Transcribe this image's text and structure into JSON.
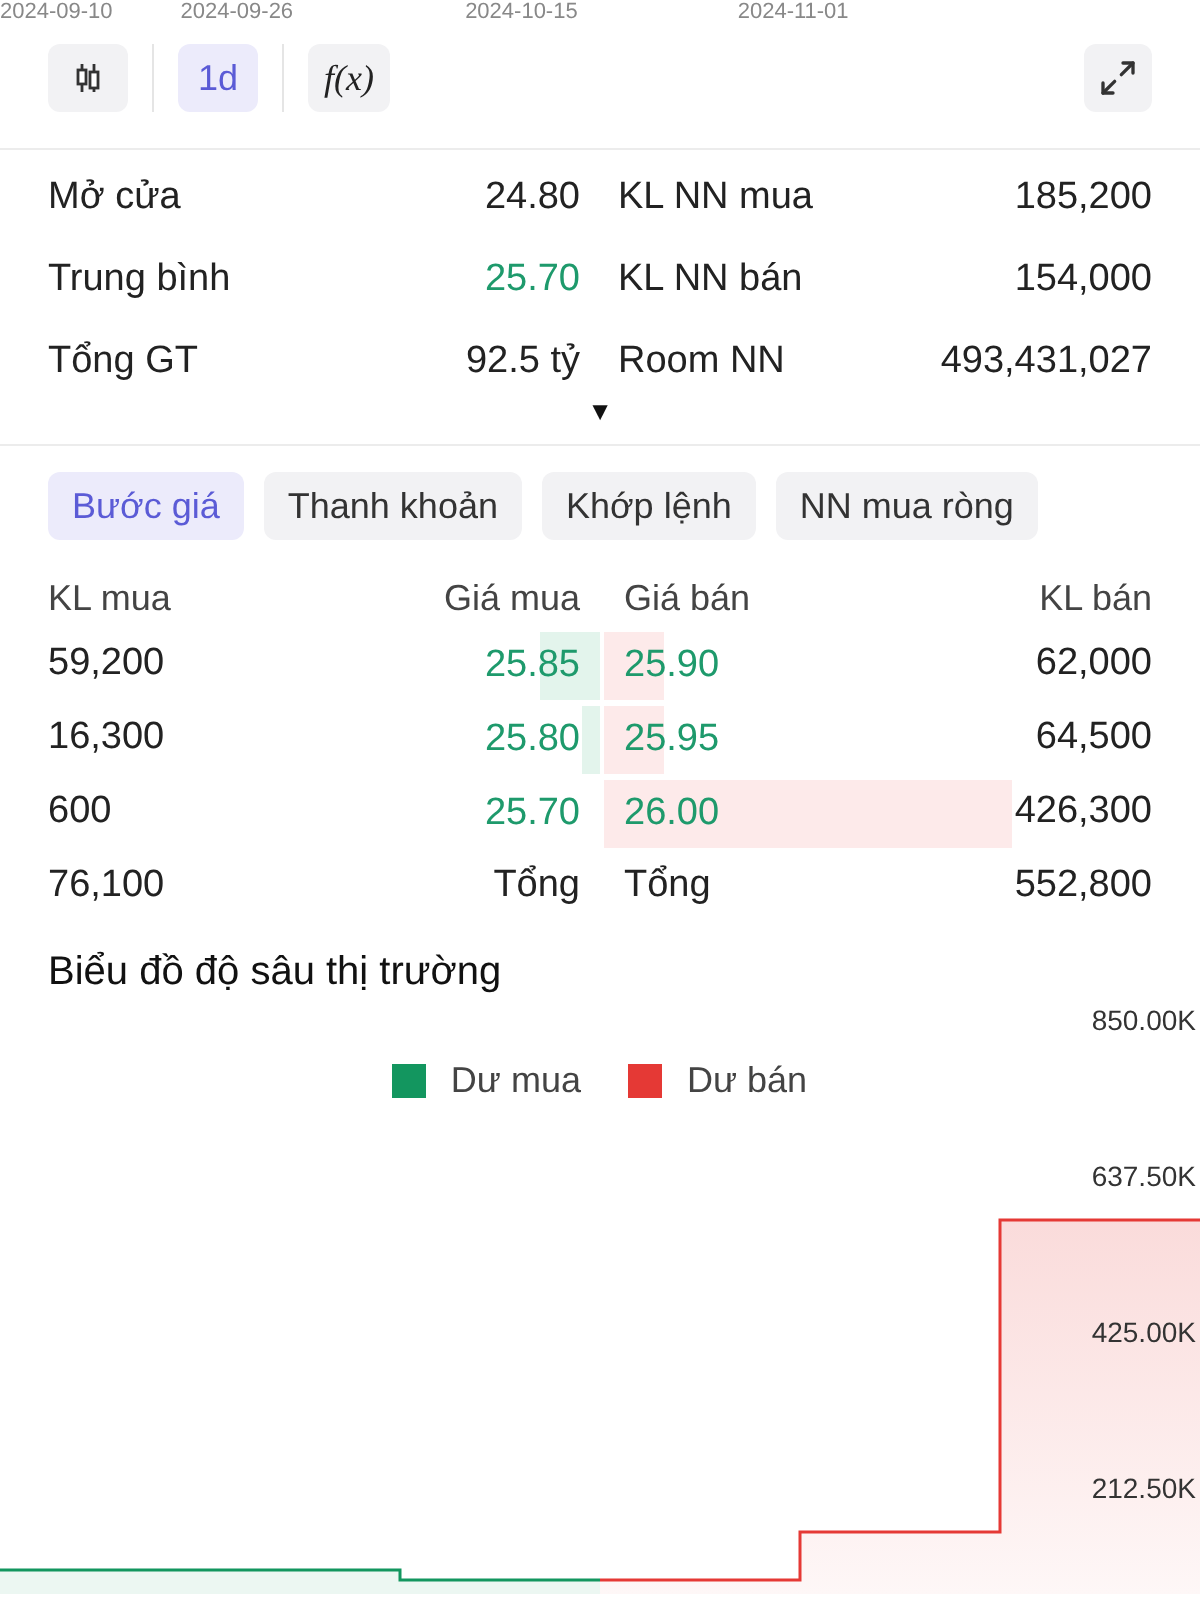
{
  "dates": [
    "2024-09-10",
    "2024-09-26",
    "2024-10-15",
    "2024-11-01"
  ],
  "toolbar": [
    {
      "kind": "candles",
      "selected": false
    },
    {
      "kind": "text",
      "label": "1d",
      "selected": true
    },
    {
      "kind": "text",
      "label": "f(x)",
      "selected": false
    }
  ],
  "stats": [
    {
      "label": "Mở cửa",
      "value": "24.80",
      "color": "#222222",
      "label2": "KL NN mua",
      "value2": "185,200"
    },
    {
      "label": "Trung bình",
      "value": "25.70",
      "color": "#1e9a6c",
      "label2": "KL NN bán",
      "value2": "154,000"
    },
    {
      "label": "Tổng GT",
      "value": "92.5 tỷ",
      "color": "#222222",
      "label2": "Room NN",
      "value2": "493,431,027"
    }
  ],
  "expand_marker": "▼",
  "tabs": [
    {
      "label": "Bước giá",
      "selected": true
    },
    {
      "label": "Thanh khoản",
      "selected": false
    },
    {
      "label": "Khớp lệnh",
      "selected": false
    },
    {
      "label": "NN mua ròng",
      "selected": false
    }
  ],
  "order_book": {
    "columns": [
      "KL mua",
      "Giá mua",
      "Giá bán",
      "KL bán"
    ],
    "rows": [
      {
        "buy_volume": "59,200",
        "buy_price": "25.85",
        "sell_price": "25.90",
        "sell_volume": "62,000"
      },
      {
        "buy_volume": "16,300",
        "buy_price": "25.80",
        "sell_price": "25.95",
        "sell_volume": "64,500"
      },
      {
        "buy_volume": "600",
        "buy_price": "25.70",
        "sell_price": "26.00",
        "sell_volume": "426,300"
      }
    ],
    "total_buy": "76,100",
    "total_buy_label": "Tổng",
    "total_sell_label": "Tổng",
    "total_sell": "552,800"
  },
  "depth_chart": {
    "title": "Biểu đồ độ sâu thị trường",
    "legend": [
      {
        "label": "Dư mua",
        "color": "#13965f"
      },
      {
        "label": "Dư bán",
        "color": "#e53935"
      }
    ],
    "axis_labels": [
      "850.00K",
      "637.50K",
      "425.00K",
      "212.50K"
    ]
  }
}
